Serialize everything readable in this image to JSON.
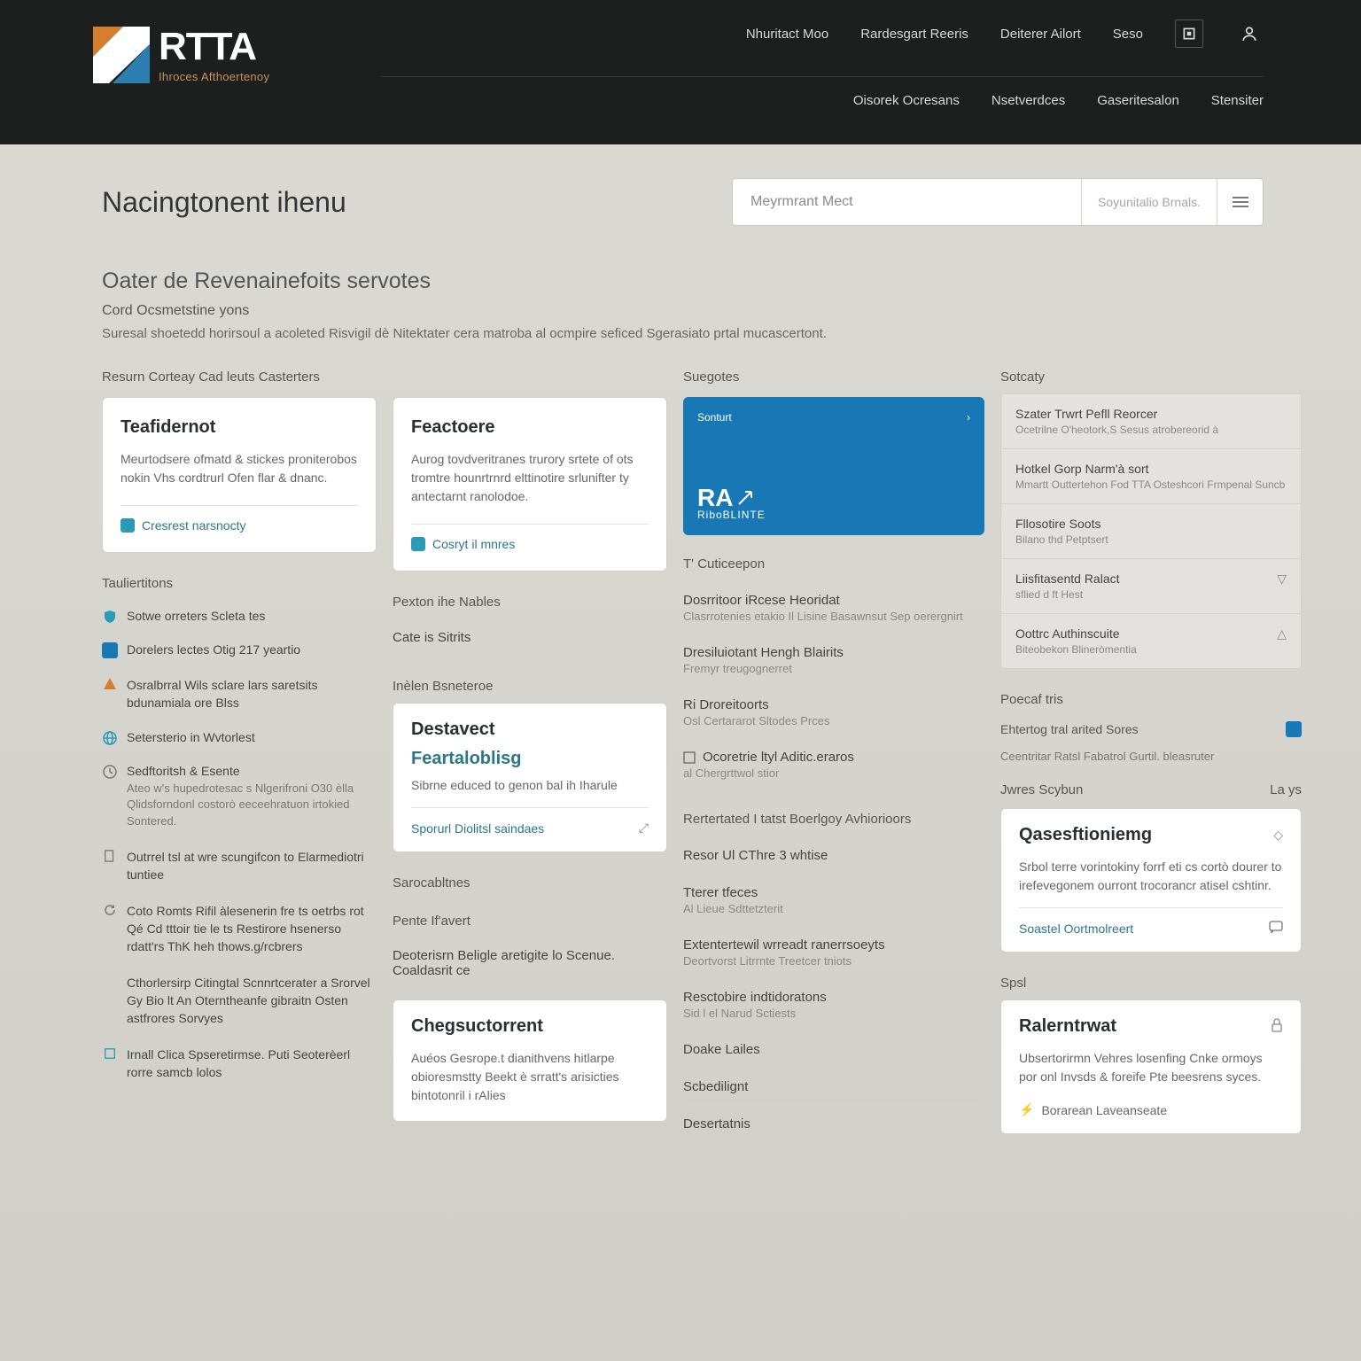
{
  "logo": {
    "main": "RTTA",
    "sub": "Ihroces Afthoertenoy"
  },
  "topnav": [
    "Nhuritact Moo",
    "Rardesgart Reeris",
    "Deiterer Ailort",
    "Seso"
  ],
  "subnav": [
    "Oisorek Ocresans",
    "Nsetverdces",
    "Gaseritesalon",
    "Stensiter"
  ],
  "page": {
    "title": "Nacingtonent ihenu"
  },
  "search": {
    "placeholder": "Meyrmrant Mect",
    "hint": "Soyunitalio Brnals."
  },
  "section": {
    "heading": "Oater de Revenainefoits servotes",
    "sub": "Cord Ocsmetstine yons",
    "desc": "Suresal shoetedd horirsoul a acoleted Risvigil dè Nitektater cera matroba al ocmpire seficed Sgerasiato prtal mucascertont."
  },
  "col1": {
    "header": "Resurn Corteay Cad leuts Casterters",
    "card1": {
      "title": "Teafidernot",
      "body": "Meurtodsere ofmatd & stickes proniterobos nokin Vhs cordtrurl Ofen flar & dnanc.",
      "footer": "Cresrest narsnocty"
    },
    "sect1": "Tauliertitons",
    "items": [
      {
        "icon": "shield",
        "text": "Sotwe orreters Scleta tes"
      },
      {
        "icon": "square-blue",
        "text": "Dorelers lectes Otig 217 yeartio"
      },
      {
        "icon": "warning",
        "text": "Osralbrral Wils sclare lars saretsits bdunamiala ore Blss"
      },
      {
        "icon": "globe",
        "text": "Setersterio in Wvtorlest"
      },
      {
        "icon": "clock",
        "text": "Sedftoritsh & Esente",
        "sub": "Ateo w's hupedrotesac s Nlgerifroni O30 èlla Qlidsforndonl costorò eeceehratuon irtokied Sontered."
      },
      {
        "icon": "doc",
        "text": "Outrrel tsl at wre scungifcon to Elarmediotri tuntiee"
      },
      {
        "icon": "refresh",
        "text": "Coto Romts Rifil àlesenerin fre ts oetrbs rot Qé Cd tttoir tie le ts Restirore hsenerso rdatt'rs ThK heh thows.g/rcbrers"
      },
      {
        "icon": "none",
        "text": "Cthorlersirp Citingtal Scnnrtcerater a Srorvel Gy Bio lt An Oterntheanfe gibraitn Osten astfrores Sorvyes"
      },
      {
        "icon": "square",
        "text": "Irnall Clica Spseretirmse. Puti Seoterèerl rorre samcb lolos"
      }
    ]
  },
  "col2": {
    "card1": {
      "title": "Feactoere",
      "body": "Aurog tovdveritranes trurory srtete of ots tromtre hounrtrnrd elttinotire srlunifter ty antectarnt ranolodoe.",
      "footer": "Cosryt il mnres"
    },
    "sect1": "Pexton ihe Nables",
    "item1": "Cate is Sitrits",
    "sect2": "Inèlen Bsneteroe",
    "card2": {
      "title": "Destavect",
      "subtitle": "Feartaloblisg",
      "body": "Sibrne educed to genon bal ih Iharule",
      "link": "Sporurl Diolitsl saindaes"
    },
    "sect3": "Sarocabltnes",
    "sect4": "Pente If'avert",
    "item2": "Deoterisrn Beligle aretigite lo Scenue. Coaldasrit ce",
    "card3": {
      "title": "Chegsuctorrent",
      "body": "Auéos Gesrope.t dianithvens hitlarpe obioresmstty Beekt è srratt's arisicties bintotonril i rAlies"
    }
  },
  "col3": {
    "header": "Suegotes",
    "promo": {
      "badge": "Sonturt",
      "logo": "RA",
      "sub": "RiboBLINTE"
    },
    "sect1": "T' Cuticeepon",
    "items1": [
      {
        "title": "Dosrritoor iRcese Heoridat",
        "sub": "Clasrrotenies etakio Il Lisine Basawnsut Sep oerergnirt"
      },
      {
        "title": "Dresiluiotant Hengh Blairits",
        "sub": "Fremyr treugognerret"
      },
      {
        "title": "Ri Droreitoorts",
        "sub": "Osl Certararot Sltodes Prces"
      },
      {
        "title": "Ocoretrie ltyl Aditic.eraros",
        "sub": "al Chergrttwol stior",
        "icon": true
      }
    ],
    "sect2": "Rertertated I tatst Boerlgoy Avhiorioors",
    "items2": [
      {
        "title": "Resor Ul CThre 3 whtise"
      },
      {
        "title": "Tterer tfeces",
        "sub": "Al Lieue Sdttetzterit"
      },
      {
        "title": "Extentertewil wrreadt ranerrsoeyts",
        "sub": "Deortvorst Litrrnte Treetcer tniots"
      },
      {
        "title": "Resctobire indtidoratons",
        "sub": "Sid l el Narud Sctiests"
      }
    ],
    "items3": [
      "Doake Lailes",
      "Scbedilignt",
      "Desertatnis"
    ]
  },
  "col4": {
    "header": "Sotcaty",
    "items": [
      {
        "title": "Szater Trwrt Pefll Reorcer",
        "sub": "Ocetrilne O'heotork,S Sesus atrobereorid à"
      },
      {
        "title": "Hotkel Gorp Narm'à sort",
        "sub": "Mmartt Outtertehon Fod TTA Osteshcori Frmpenal Suncb"
      },
      {
        "title": "Fllosotire Soots",
        "sub": "Bilano thd Petptsert"
      },
      {
        "title": "Liisfitasentd Ralact",
        "sub": "sflied d ft Hest",
        "chev": "down"
      },
      {
        "title": "Oottrc Authinscuite",
        "sub": "Biteobekon Blineròmentia",
        "chev": "up"
      }
    ],
    "sect2": "Poecaf tris",
    "item2": {
      "text": "Ehtertog tral arited Sores",
      "icon": true
    },
    "item3": "Ceentritar Ratsl Fabatrol Gurtil. bleasruter",
    "sect3": "Jwres Scybun",
    "sect3r": "La ys",
    "qcard": {
      "title": "Qasesftioniemg",
      "body": "Srbol terre vorintokiny forrf eti cs cortò dourer to irefevegonem ourront trocorancr atisel cshtinr.",
      "link": "Soastel Oortmolreert"
    },
    "sect4": "Spsl",
    "rcard": {
      "title": "Ralerntrwat",
      "body": "Ubsertorirmn Vehres losenfing Cnke ormoys por onl Invsds & foreife Pte beesrens syces.",
      "footer": "Borarean Laveanseate"
    }
  }
}
